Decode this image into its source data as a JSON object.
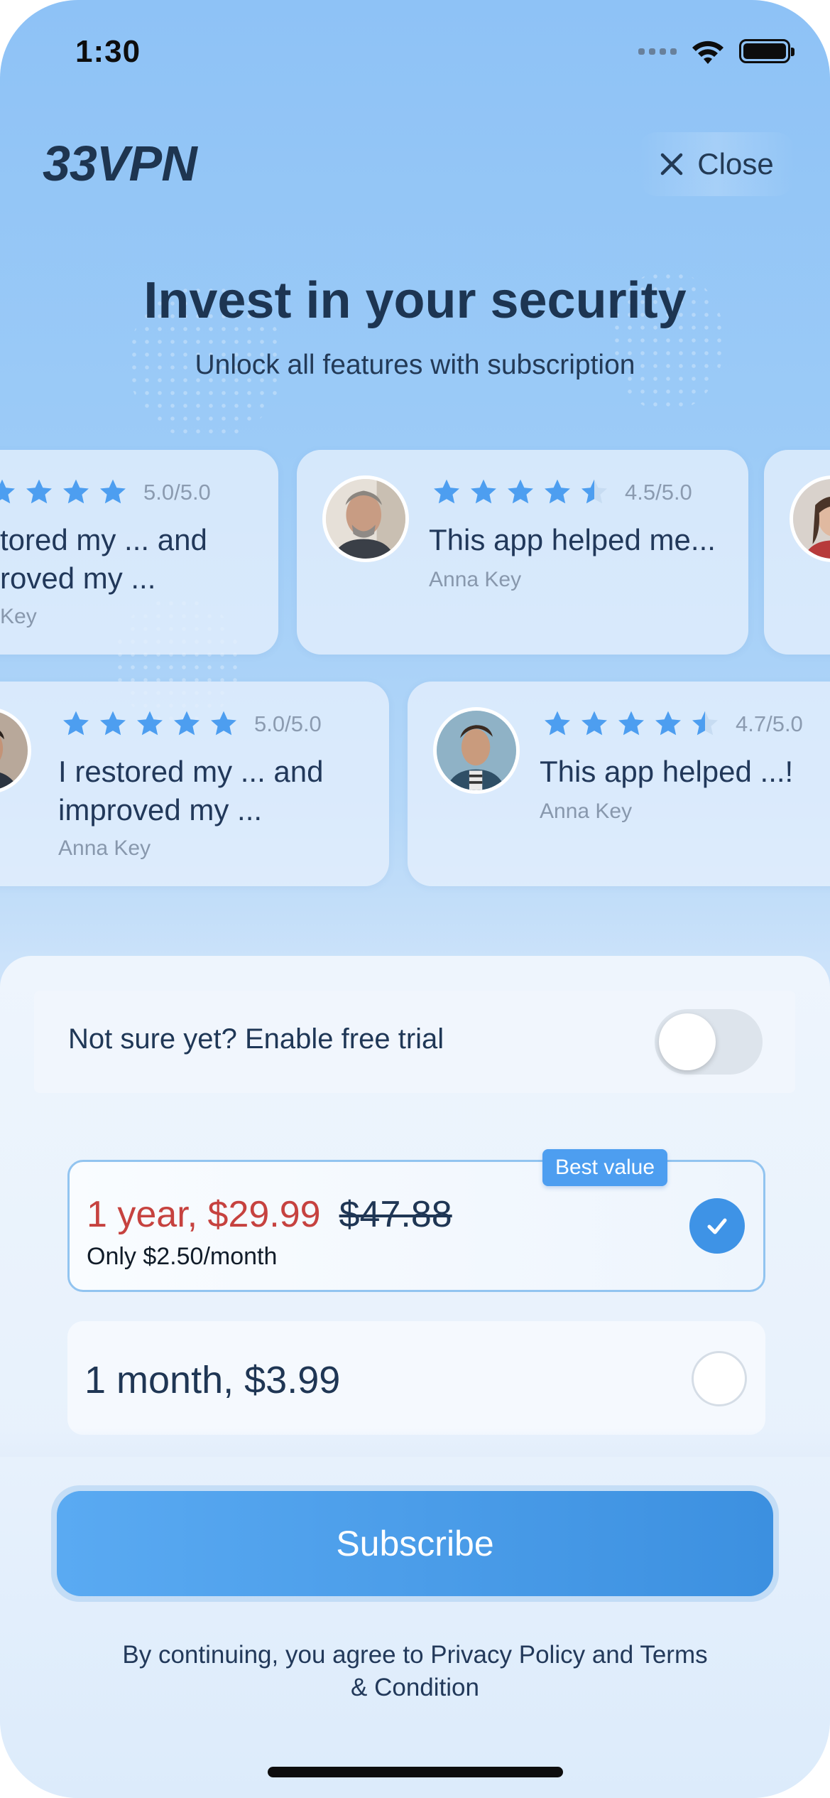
{
  "status_bar": {
    "time": "1:30"
  },
  "header": {
    "logo": "33VPN",
    "close_label": "Close"
  },
  "hero": {
    "title": "Invest in your security",
    "subtitle": "Unlock all features with subscription"
  },
  "reviews": [
    {
      "rating": "5.0/5.0",
      "stars": 5,
      "text_line1": "tored my ... and",
      "text_line2": "roved my ...",
      "author": " Key"
    },
    {
      "rating": "4.5/5.0",
      "stars": 4.5,
      "text_line1": "This app helped me...",
      "author": "Anna Key"
    },
    {
      "rating": "5.0/5.0",
      "stars": 5,
      "text_line1": "I restored my ... and",
      "text_line2": "improved my ...",
      "author": "Anna Key"
    },
    {
      "rating": "4.7/5.0",
      "stars": 4.7,
      "text_line1": "This app helped ...!",
      "author": "Anna Key"
    }
  ],
  "trial": {
    "label": "Not sure yet? Enable free trial",
    "enabled": false
  },
  "plans": [
    {
      "title": "1 year, $29.99",
      "old_price": "$47.88",
      "subtitle": "Only $2.50/month",
      "badge": "Best value",
      "selected": true
    },
    {
      "title": "1 month, $3.99",
      "selected": false
    }
  ],
  "cta": {
    "subscribe_label": "Subscribe"
  },
  "legal": {
    "line1": "By continuing, you agree to Privacy Policy and Terms",
    "line2": "& Condition"
  },
  "colors": {
    "accent": "#3e93e6",
    "sale_red": "#c6423f",
    "star_blue": "#4d9ef0"
  }
}
